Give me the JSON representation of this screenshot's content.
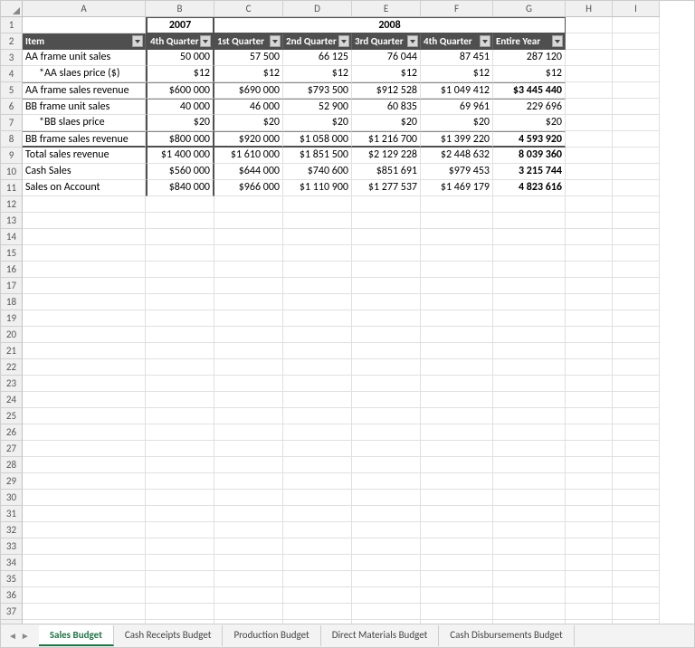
{
  "columns": [
    "A",
    "B",
    "C",
    "D",
    "E",
    "F",
    "G",
    "H",
    "I"
  ],
  "rowCount": 38,
  "year1": "2007",
  "year2": "2008",
  "headers": {
    "item": "Item",
    "q4_2007": "4th Quarter",
    "q1": "1st Quarter",
    "q2": "2nd Quarter",
    "q3": "3rd Quarter",
    "q4": "4th Quarter",
    "year": "Entire Year"
  },
  "rows": [
    {
      "label": "AA frame unit sales",
      "v": [
        "50 000",
        "57 500",
        "66 125",
        "76 044",
        "87 451",
        "287 120"
      ]
    },
    {
      "label": "*AA slaes price ($)",
      "indent": true,
      "v": [
        "$12",
        "$12",
        "$12",
        "$12",
        "$12",
        "$12"
      ]
    },
    {
      "label": "AA frame sales revenue",
      "topBorder": "thin",
      "v": [
        "$600 000",
        "$690 000",
        "$793 500",
        "$912 528",
        "$1 049 412",
        "$3 445 440"
      ],
      "boldLast": true
    },
    {
      "label": "BB frame unit sales",
      "topBorder": "thin",
      "v": [
        "40 000",
        "46 000",
        "52 900",
        "60 835",
        "69 961",
        "229 696"
      ]
    },
    {
      "label": "*BB slaes price",
      "indent": true,
      "v": [
        "$20",
        "$20",
        "$20",
        "$20",
        "$20",
        "$20"
      ]
    },
    {
      "label": "BB frame sales revenue",
      "topBorder": "thin",
      "bottomThick": true,
      "v": [
        "$800 000",
        "$920 000",
        "$1 058 000",
        "$1 216 700",
        "$1 399 220",
        "4 593 920"
      ],
      "boldLast": true
    },
    {
      "label": "Total sales revenue",
      "v": [
        "$1 400 000",
        "$1 610 000",
        "$1 851 500",
        "$2 129 228",
        "$2 448 632",
        "8 039 360"
      ],
      "boldLast": true
    },
    {
      "label": "Cash Sales",
      "v": [
        "$560 000",
        "$644 000",
        "$740 600",
        "$851 691",
        "$979 453",
        "3 215 744"
      ],
      "boldLast": true
    },
    {
      "label": "Sales on Account",
      "v": [
        "$840 000",
        "$966 000",
        "$1 110 900",
        "$1 277 537",
        "$1 469 179",
        "4 823 616"
      ],
      "boldLast": true
    }
  ],
  "tabs": [
    "Sales Budget",
    "Cash Receipts Budget",
    "Production Budget",
    "Direct Materials Budget",
    "Cash Disbursements Budget"
  ],
  "activeTab": 0,
  "chart_data": {
    "type": "table",
    "title": "Sales Budget",
    "columns": [
      "Item",
      "2007 4th Quarter",
      "2008 1st Quarter",
      "2008 2nd Quarter",
      "2008 3rd Quarter",
      "2008 4th Quarter",
      "2008 Entire Year"
    ],
    "rows": [
      [
        "AA frame unit sales",
        50000,
        57500,
        66125,
        76044,
        87451,
        287120
      ],
      [
        "*AA slaes price ($)",
        12,
        12,
        12,
        12,
        12,
        12
      ],
      [
        "AA frame sales revenue",
        600000,
        690000,
        793500,
        912528,
        1049412,
        3445440
      ],
      [
        "BB frame unit sales",
        40000,
        46000,
        52900,
        60835,
        69961,
        229696
      ],
      [
        "*BB slaes price",
        20,
        20,
        20,
        20,
        20,
        20
      ],
      [
        "BB frame sales revenue",
        800000,
        920000,
        1058000,
        1216700,
        1399220,
        4593920
      ],
      [
        "Total sales revenue",
        1400000,
        1610000,
        1851500,
        2129228,
        2448632,
        8039360
      ],
      [
        "Cash Sales",
        560000,
        644000,
        740600,
        851691,
        979453,
        3215744
      ],
      [
        "Sales on Account",
        840000,
        966000,
        1110900,
        1277537,
        1469179,
        4823616
      ]
    ]
  }
}
